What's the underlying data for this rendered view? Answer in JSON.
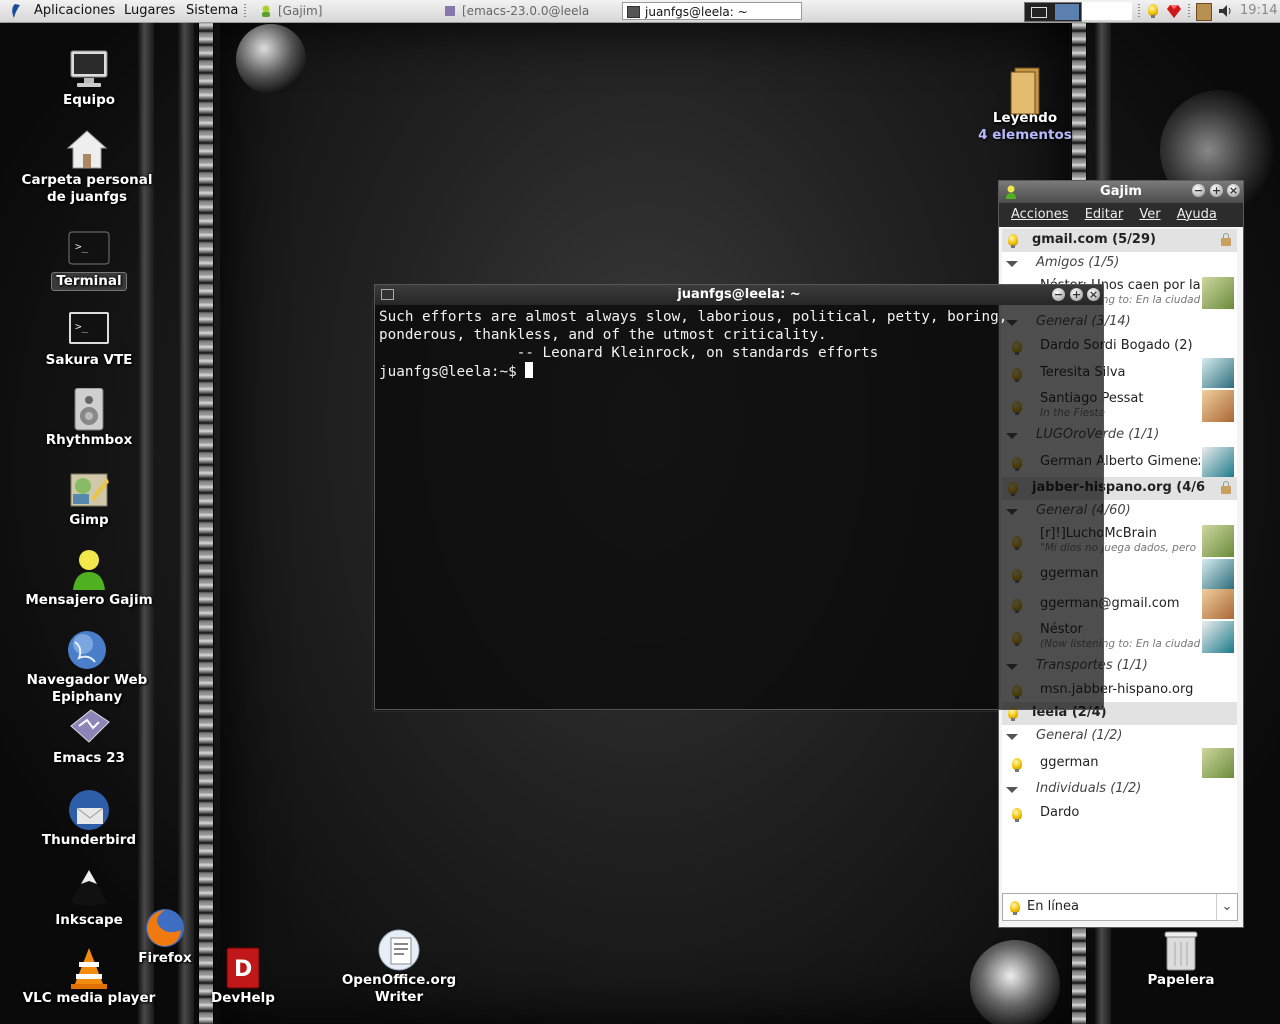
{
  "top_panel": {
    "menus": [
      "Aplicaciones",
      "Lugares",
      "Sistema"
    ],
    "tasks": [
      {
        "label": "[Gajim]",
        "active": false
      },
      {
        "label": "[emacs-23.0.0@leela",
        "active": false
      },
      {
        "label": "juanfgs@leela: ~",
        "active": true
      }
    ],
    "clock": "19:14"
  },
  "desktop_icons": [
    {
      "id": "equipo",
      "label": "Equipo",
      "icon": "computer-icon"
    },
    {
      "id": "home",
      "label": "Carpeta personal de juanfgs",
      "icon": "home-folder-icon"
    },
    {
      "id": "terminal",
      "label": "Terminal",
      "icon": "terminal-icon"
    },
    {
      "id": "sakura",
      "label": "Sakura VTE",
      "icon": "terminal-icon"
    },
    {
      "id": "rhythmbox",
      "label": "Rhythmbox",
      "icon": "speaker-icon"
    },
    {
      "id": "gimp",
      "label": "Gimp",
      "icon": "gimp-icon"
    },
    {
      "id": "gajim",
      "label": "Mensajero Gajim",
      "icon": "gajim-icon"
    },
    {
      "id": "epiphany",
      "label": "Navegador Web Epiphany",
      "icon": "globe-icon"
    },
    {
      "id": "emacs",
      "label": "Emacs 23",
      "icon": "emacs-icon"
    },
    {
      "id": "thunderbird",
      "label": "Thunderbird",
      "icon": "thunderbird-icon"
    },
    {
      "id": "inkscape",
      "label": "Inkscape",
      "icon": "inkscape-icon"
    },
    {
      "id": "vlc",
      "label": "VLC media player",
      "icon": "vlc-cone-icon"
    },
    {
      "id": "firefox",
      "label": "Firefox",
      "icon": "firefox-icon"
    },
    {
      "id": "devhelp",
      "label": "DevHelp",
      "icon": "devhelp-book-icon"
    },
    {
      "id": "writer",
      "label": "OpenOffice.org Writer",
      "icon": "writer-doc-icon"
    },
    {
      "id": "leyendo",
      "label": "Leyendo",
      "sublabel": "4 elementos",
      "icon": "folder-icon"
    },
    {
      "id": "papelera",
      "label": "Papelera",
      "icon": "trash-icon"
    }
  ],
  "terminal": {
    "title": "juanfgs@leela: ~",
    "lines": [
      "Such efforts are almost always slow, laborious, political, petty, boring,",
      "ponderous, thankless, and of the utmost criticality.",
      "                -- Leonard Kleinrock, on standards efforts",
      "juanfgs@leela:~$ "
    ]
  },
  "gajim": {
    "title": "Gajim",
    "menu": [
      "Acciones",
      "Editar",
      "Ver",
      "Ayuda"
    ],
    "rows": [
      {
        "type": "account",
        "text": "gmail.com (5/29)",
        "lock": true
      },
      {
        "type": "group",
        "text": "Amigos (1/5)"
      },
      {
        "type": "contact",
        "text": "Néstor: Unos caen por la",
        "sub": "(Now listening to: En la ciudad de",
        "avatar": true
      },
      {
        "type": "group",
        "text": "General (3/14)"
      },
      {
        "type": "contact",
        "text": "Dardo Sordi Bogado (2)"
      },
      {
        "type": "contact",
        "text": "Teresita Silva",
        "avatar": true
      },
      {
        "type": "contact",
        "text": "Santiago Pessat",
        "sub": "In the Fiesta",
        "avatar": true
      },
      {
        "type": "group",
        "text": "LUGOroVerde (1/1)"
      },
      {
        "type": "contact",
        "text": "German Alberto Gimenez S",
        "avatar": true
      },
      {
        "type": "account",
        "text": "jabber-hispano.org (4/6",
        "lock": true
      },
      {
        "type": "group",
        "text": "General (4/60)"
      },
      {
        "type": "contact",
        "text": "[r]!]LuchoMcBrain",
        "sub": "\"Mi dios no juega dados, pero ho",
        "avatar": true
      },
      {
        "type": "contact",
        "text": "ggerman",
        "avatar": true
      },
      {
        "type": "contact",
        "text": "ggerman@gmail.com",
        "avatar": true
      },
      {
        "type": "contact",
        "text": "Néstor",
        "sub": "(Now listening to: En la ciudad de",
        "avatar": true
      },
      {
        "type": "group",
        "text": "Transportes (1/1)"
      },
      {
        "type": "contact",
        "text": "msn.jabber-hispano.org"
      },
      {
        "type": "account",
        "text": "leela (2/4)"
      },
      {
        "type": "group",
        "text": "General (1/2)"
      },
      {
        "type": "contact",
        "text": "ggerman",
        "avatar": true
      },
      {
        "type": "group",
        "text": "Individuals (1/2)"
      },
      {
        "type": "contact",
        "text": "Dardo"
      }
    ],
    "status": "En línea"
  }
}
